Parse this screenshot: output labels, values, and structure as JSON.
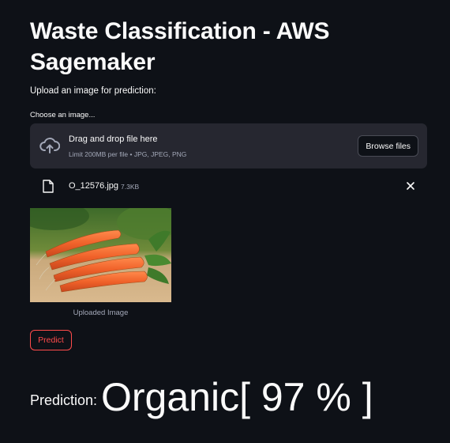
{
  "page": {
    "title": "Waste Classification - AWS Sagemaker",
    "subtitle": "Upload an image for prediction:"
  },
  "uploader": {
    "label": "Choose an image...",
    "drop_text": "Drag and drop file here",
    "limit_text": "Limit 200MB per file • JPG, JPEG, PNG",
    "browse_label": "Browse files",
    "icon": "cloud-upload-icon"
  },
  "file": {
    "name": "O_12576.jpg",
    "size": "7.3KB",
    "icon": "file-icon",
    "remove_icon": "close-icon"
  },
  "image": {
    "caption": "Uploaded Image"
  },
  "predict": {
    "label": "Predict"
  },
  "result": {
    "label": "Prediction:",
    "value": "Organic[ 97 % ]"
  },
  "colors": {
    "background": "#0e1117",
    "surface": "#262730",
    "text": "#fafafa",
    "muted": "#a3a8b8",
    "accent": "#ff4b4b"
  }
}
